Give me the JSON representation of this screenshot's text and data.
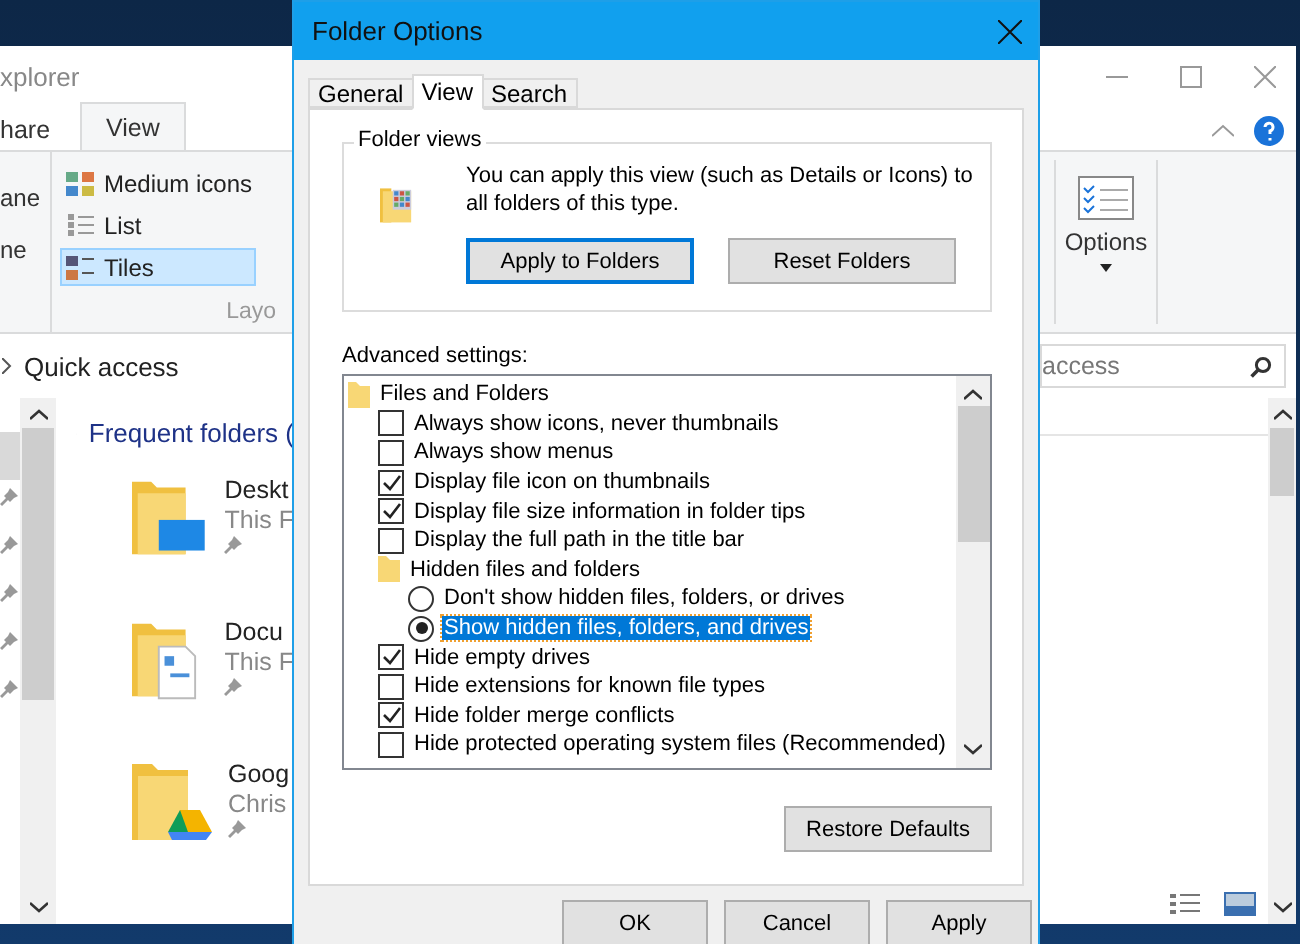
{
  "explorer": {
    "title": "xplorer",
    "ribbon_tabs": [
      {
        "label": "hare",
        "selected": false
      },
      {
        "label": "View",
        "selected": true
      }
    ],
    "pane_items": [
      "ane",
      "ne"
    ],
    "layouts": [
      {
        "label": "Medium icons",
        "selected": false
      },
      {
        "label": "List",
        "selected": false
      },
      {
        "label": "Tiles",
        "selected": true
      }
    ],
    "group_label": "Layo",
    "options_label": "Options",
    "address": "Quick access",
    "search": {
      "value": "access"
    },
    "section_title": "Frequent folders (",
    "folders": [
      {
        "name": "Deskt",
        "location": "This F",
        "kind": "desktop"
      },
      {
        "name": "Docu",
        "location": "This F",
        "kind": "documents"
      },
      {
        "name": "Goog",
        "location": "Chris",
        "kind": "drive"
      }
    ]
  },
  "dialog": {
    "title": "Folder Options",
    "tabs": [
      {
        "label": "General",
        "selected": false
      },
      {
        "label": "View",
        "selected": true
      },
      {
        "label": "Search",
        "selected": false
      }
    ],
    "folder_views": {
      "title": "Folder views",
      "text": "You can apply this view (such as Details or Icons) to all folders of this type.",
      "buttons": [
        "Apply to Folders",
        "Reset Folders"
      ]
    },
    "advanced_label": "Advanced settings:",
    "settings": [
      {
        "kind": "folder",
        "label": "Files and Folders",
        "children": [
          {
            "kind": "checkbox",
            "label": "Always show icons, never thumbnails",
            "checked": false
          },
          {
            "kind": "checkbox",
            "label": "Always show menus",
            "checked": false
          },
          {
            "kind": "checkbox",
            "label": "Display file icon on thumbnails",
            "checked": true
          },
          {
            "kind": "checkbox",
            "label": "Display file size information in folder tips",
            "checked": true
          },
          {
            "kind": "checkbox",
            "label": "Display the full path in the title bar",
            "checked": false
          },
          {
            "kind": "folder",
            "label": "Hidden files and folders",
            "children": [
              {
                "kind": "radio",
                "label": "Don't show hidden files, folders, or drives",
                "selected": false
              },
              {
                "kind": "radio",
                "label": "Show hidden files, folders, and drives",
                "selected": true
              }
            ]
          },
          {
            "kind": "checkbox",
            "label": "Hide empty drives",
            "checked": true
          },
          {
            "kind": "checkbox",
            "label": "Hide extensions for known file types",
            "checked": false
          },
          {
            "kind": "checkbox",
            "label": "Hide folder merge conflicts",
            "checked": true
          },
          {
            "kind": "checkbox",
            "label": "Hide protected operating system files (Recommended)",
            "checked": false
          }
        ]
      }
    ],
    "restore_button": "Restore Defaults",
    "buttons": [
      "OK",
      "Cancel",
      "Apply"
    ]
  }
}
